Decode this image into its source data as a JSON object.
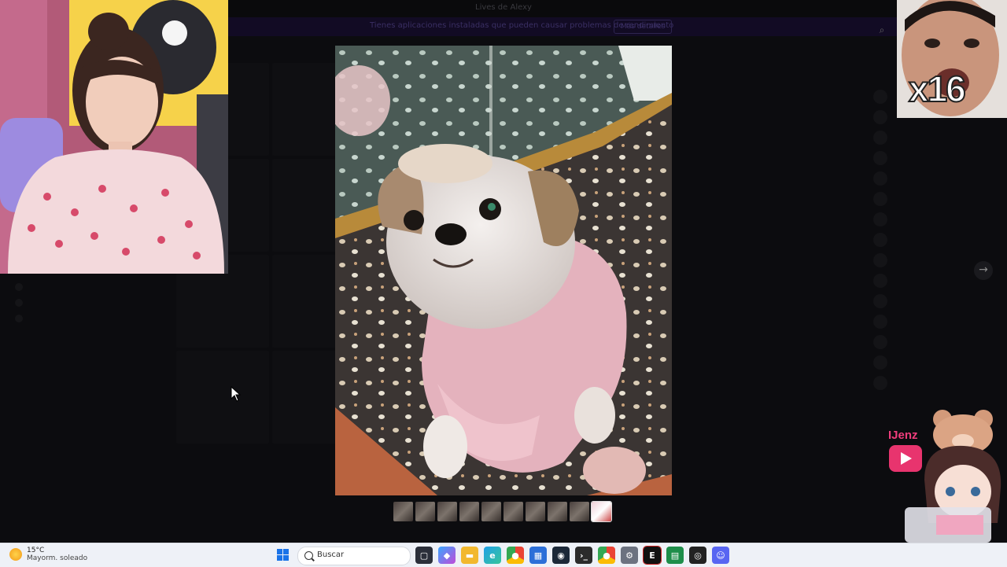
{
  "app": {
    "window_title": "Lives de Alexy"
  },
  "banner": {
    "text": "Tienes aplicaciones instaladas que pueden causar problemas de rendimiento",
    "button": "Más detalles"
  },
  "viewer": {
    "next_arrow": "→",
    "thumbnail_count": 10,
    "active_thumbnail": 10
  },
  "overlay": {
    "reaction_label": "x16",
    "streamer_name": "IJenz"
  },
  "taskbar": {
    "temperature": "15°C",
    "weather_desc": "Mayorm. soleado",
    "search_placeholder": "Buscar",
    "icons": [
      "task-view-icon",
      "copilot-icon",
      "file-explorer-icon",
      "edge-icon",
      "chrome-icon",
      "store-icon",
      "steam-icon",
      "terminal-icon",
      "chrome-dev-icon",
      "settings-icon",
      "epic-games-icon",
      "spreadsheet-icon",
      "obs-icon",
      "discord-icon"
    ]
  },
  "colors": {
    "accent": "#e8346e",
    "taskbar_bg": "#eef1f7",
    "banner_bg": "#120b24"
  }
}
